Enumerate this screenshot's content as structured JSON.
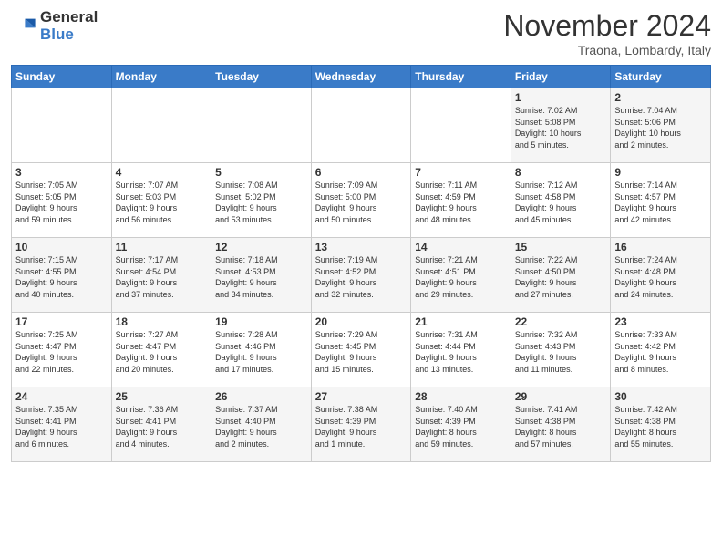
{
  "logo": {
    "line1": "General",
    "line2": "Blue"
  },
  "header": {
    "month": "November 2024",
    "location": "Traona, Lombardy, Italy"
  },
  "days_of_week": [
    "Sunday",
    "Monday",
    "Tuesday",
    "Wednesday",
    "Thursday",
    "Friday",
    "Saturday"
  ],
  "weeks": [
    [
      {
        "day": "",
        "info": ""
      },
      {
        "day": "",
        "info": ""
      },
      {
        "day": "",
        "info": ""
      },
      {
        "day": "",
        "info": ""
      },
      {
        "day": "",
        "info": ""
      },
      {
        "day": "1",
        "info": "Sunrise: 7:02 AM\nSunset: 5:08 PM\nDaylight: 10 hours\nand 5 minutes."
      },
      {
        "day": "2",
        "info": "Sunrise: 7:04 AM\nSunset: 5:06 PM\nDaylight: 10 hours\nand 2 minutes."
      }
    ],
    [
      {
        "day": "3",
        "info": "Sunrise: 7:05 AM\nSunset: 5:05 PM\nDaylight: 9 hours\nand 59 minutes."
      },
      {
        "day": "4",
        "info": "Sunrise: 7:07 AM\nSunset: 5:03 PM\nDaylight: 9 hours\nand 56 minutes."
      },
      {
        "day": "5",
        "info": "Sunrise: 7:08 AM\nSunset: 5:02 PM\nDaylight: 9 hours\nand 53 minutes."
      },
      {
        "day": "6",
        "info": "Sunrise: 7:09 AM\nSunset: 5:00 PM\nDaylight: 9 hours\nand 50 minutes."
      },
      {
        "day": "7",
        "info": "Sunrise: 7:11 AM\nSunset: 4:59 PM\nDaylight: 9 hours\nand 48 minutes."
      },
      {
        "day": "8",
        "info": "Sunrise: 7:12 AM\nSunset: 4:58 PM\nDaylight: 9 hours\nand 45 minutes."
      },
      {
        "day": "9",
        "info": "Sunrise: 7:14 AM\nSunset: 4:57 PM\nDaylight: 9 hours\nand 42 minutes."
      }
    ],
    [
      {
        "day": "10",
        "info": "Sunrise: 7:15 AM\nSunset: 4:55 PM\nDaylight: 9 hours\nand 40 minutes."
      },
      {
        "day": "11",
        "info": "Sunrise: 7:17 AM\nSunset: 4:54 PM\nDaylight: 9 hours\nand 37 minutes."
      },
      {
        "day": "12",
        "info": "Sunrise: 7:18 AM\nSunset: 4:53 PM\nDaylight: 9 hours\nand 34 minutes."
      },
      {
        "day": "13",
        "info": "Sunrise: 7:19 AM\nSunset: 4:52 PM\nDaylight: 9 hours\nand 32 minutes."
      },
      {
        "day": "14",
        "info": "Sunrise: 7:21 AM\nSunset: 4:51 PM\nDaylight: 9 hours\nand 29 minutes."
      },
      {
        "day": "15",
        "info": "Sunrise: 7:22 AM\nSunset: 4:50 PM\nDaylight: 9 hours\nand 27 minutes."
      },
      {
        "day": "16",
        "info": "Sunrise: 7:24 AM\nSunset: 4:48 PM\nDaylight: 9 hours\nand 24 minutes."
      }
    ],
    [
      {
        "day": "17",
        "info": "Sunrise: 7:25 AM\nSunset: 4:47 PM\nDaylight: 9 hours\nand 22 minutes."
      },
      {
        "day": "18",
        "info": "Sunrise: 7:27 AM\nSunset: 4:47 PM\nDaylight: 9 hours\nand 20 minutes."
      },
      {
        "day": "19",
        "info": "Sunrise: 7:28 AM\nSunset: 4:46 PM\nDaylight: 9 hours\nand 17 minutes."
      },
      {
        "day": "20",
        "info": "Sunrise: 7:29 AM\nSunset: 4:45 PM\nDaylight: 9 hours\nand 15 minutes."
      },
      {
        "day": "21",
        "info": "Sunrise: 7:31 AM\nSunset: 4:44 PM\nDaylight: 9 hours\nand 13 minutes."
      },
      {
        "day": "22",
        "info": "Sunrise: 7:32 AM\nSunset: 4:43 PM\nDaylight: 9 hours\nand 11 minutes."
      },
      {
        "day": "23",
        "info": "Sunrise: 7:33 AM\nSunset: 4:42 PM\nDaylight: 9 hours\nand 8 minutes."
      }
    ],
    [
      {
        "day": "24",
        "info": "Sunrise: 7:35 AM\nSunset: 4:41 PM\nDaylight: 9 hours\nand 6 minutes."
      },
      {
        "day": "25",
        "info": "Sunrise: 7:36 AM\nSunset: 4:41 PM\nDaylight: 9 hours\nand 4 minutes."
      },
      {
        "day": "26",
        "info": "Sunrise: 7:37 AM\nSunset: 4:40 PM\nDaylight: 9 hours\nand 2 minutes."
      },
      {
        "day": "27",
        "info": "Sunrise: 7:38 AM\nSunset: 4:39 PM\nDaylight: 9 hours\nand 1 minute."
      },
      {
        "day": "28",
        "info": "Sunrise: 7:40 AM\nSunset: 4:39 PM\nDaylight: 8 hours\nand 59 minutes."
      },
      {
        "day": "29",
        "info": "Sunrise: 7:41 AM\nSunset: 4:38 PM\nDaylight: 8 hours\nand 57 minutes."
      },
      {
        "day": "30",
        "info": "Sunrise: 7:42 AM\nSunset: 4:38 PM\nDaylight: 8 hours\nand 55 minutes."
      }
    ]
  ]
}
